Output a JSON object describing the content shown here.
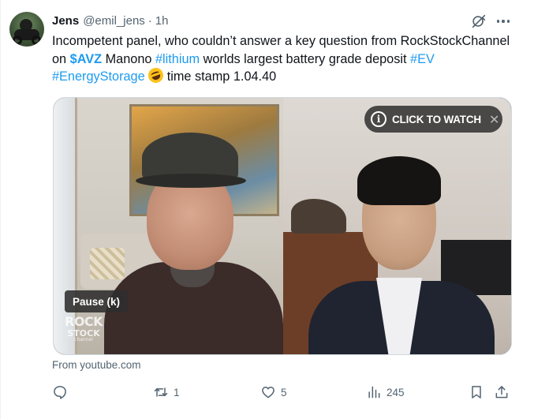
{
  "tweet": {
    "author": {
      "name": "Jens",
      "handle": "@emil_jens",
      "separator": "·",
      "time": "1h"
    },
    "text": {
      "part1": "Incompetent panel, who couldn’t answer a key question from RockStockChannel on ",
      "cashtag": "$AVZ",
      "part2": " Manono ",
      "hashtag1": "#lithium",
      "part3": " worlds largest battery grade deposit ",
      "hashtag2": "#EV",
      "space": " ",
      "hashtag3": "#EnergyStorage",
      "part4": " time stamp 1.04.40",
      "emoji": "rolling-on-the-floor-laughing"
    },
    "header_icons": [
      "grok-icon",
      "more-icon"
    ],
    "media": {
      "cta_info": "i",
      "cta_label": "CLICK TO WATCH",
      "cta_close": "✕",
      "pause_tooltip": "Pause (k)",
      "watermark": {
        "line1": "ROCK",
        "line2": "STOCK",
        "line3": "channel"
      }
    },
    "source": "From youtube.com",
    "actions": {
      "reply": {
        "icon": "reply-icon",
        "count": ""
      },
      "repost": {
        "icon": "repost-icon",
        "count": "1"
      },
      "like": {
        "icon": "heart-icon",
        "count": "5"
      },
      "views": {
        "icon": "views-icon",
        "count": "245"
      },
      "bookmark": {
        "icon": "bookmark-icon"
      },
      "share": {
        "icon": "share-icon"
      }
    },
    "colors": {
      "link": "#1d9bf0",
      "text": "#0f1419",
      "secondary": "#536471"
    }
  }
}
